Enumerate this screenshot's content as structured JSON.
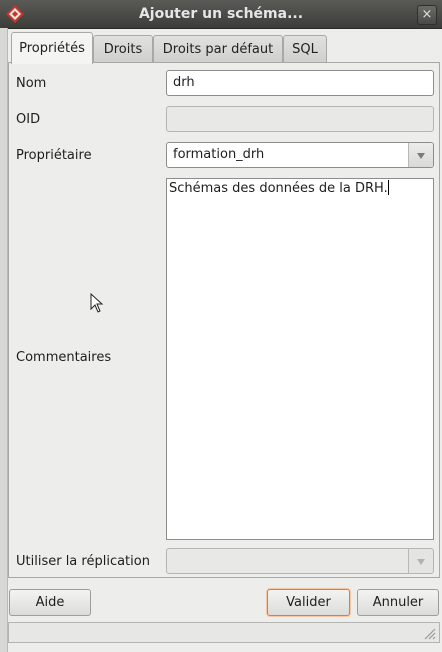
{
  "window": {
    "title": "Ajouter un schéma...",
    "icon": "pgadmin-elephant-icon",
    "close_label": "×"
  },
  "tabs": [
    {
      "label": "Propriétés",
      "active": true
    },
    {
      "label": "Droits",
      "active": false
    },
    {
      "label": "Droits par défaut",
      "active": false
    },
    {
      "label": "SQL",
      "active": false
    }
  ],
  "form": {
    "name_label": "Nom",
    "name_value": "drh",
    "oid_label": "OID",
    "oid_value": "",
    "owner_label": "Propriétaire",
    "owner_value": "formation_drh",
    "comments_label": "Commentaires",
    "comments_value": "Schémas des données de la DRH.",
    "replication_label": "Utiliser la réplication",
    "replication_value": ""
  },
  "buttons": {
    "help": "Aide",
    "validate": "Valider",
    "cancel": "Annuler"
  },
  "colors": {
    "titlebar": "#3c3c39",
    "default_button_border": "#e07b3a"
  }
}
